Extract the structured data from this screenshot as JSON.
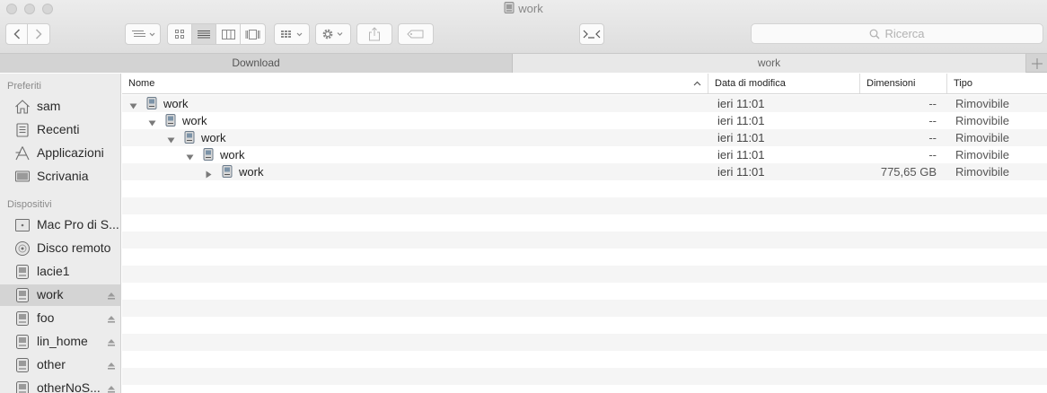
{
  "window": {
    "title": "work"
  },
  "search": {
    "placeholder": "Ricerca"
  },
  "tabs": [
    {
      "label": "Download"
    },
    {
      "label": "work"
    }
  ],
  "sidebar": {
    "favorites_header": "Preferiti",
    "favorites": [
      {
        "label": "sam",
        "icon": "home-icon"
      },
      {
        "label": "Recenti",
        "icon": "recents-icon"
      },
      {
        "label": "Applicazioni",
        "icon": "applications-icon"
      },
      {
        "label": "Scrivania",
        "icon": "desktop-icon"
      }
    ],
    "devices_header": "Dispositivi",
    "devices": [
      {
        "label": "Mac Pro di S...",
        "icon": "computer-icon",
        "eject": false
      },
      {
        "label": "Disco remoto",
        "icon": "disc-icon",
        "eject": false
      },
      {
        "label": "lacie1",
        "icon": "drive-icon",
        "eject": false
      },
      {
        "label": "work",
        "icon": "drive-icon",
        "eject": true,
        "selected": true
      },
      {
        "label": "foo",
        "icon": "drive-icon",
        "eject": true
      },
      {
        "label": "lin_home",
        "icon": "drive-icon",
        "eject": true
      },
      {
        "label": "other",
        "icon": "drive-icon",
        "eject": true
      },
      {
        "label": "otherNoS...",
        "icon": "drive-icon",
        "eject": true
      }
    ]
  },
  "columns": {
    "name": "Nome",
    "modified": "Data di modifica",
    "size": "Dimensioni",
    "kind": "Tipo"
  },
  "files": [
    {
      "name": "work",
      "level": 0,
      "expanded": true,
      "modified": "ieri 11:01",
      "size": "--",
      "kind": "Rimovibile"
    },
    {
      "name": "work",
      "level": 1,
      "expanded": true,
      "modified": "ieri 11:01",
      "size": "--",
      "kind": "Rimovibile"
    },
    {
      "name": "work",
      "level": 2,
      "expanded": true,
      "modified": "ieri 11:01",
      "size": "--",
      "kind": "Rimovibile"
    },
    {
      "name": "work",
      "level": 3,
      "expanded": true,
      "modified": "ieri 11:01",
      "size": "--",
      "kind": "Rimovibile"
    },
    {
      "name": "work",
      "level": 4,
      "expanded": false,
      "modified": "ieri 11:01",
      "size": "775,65 GB",
      "kind": "Rimovibile"
    }
  ]
}
